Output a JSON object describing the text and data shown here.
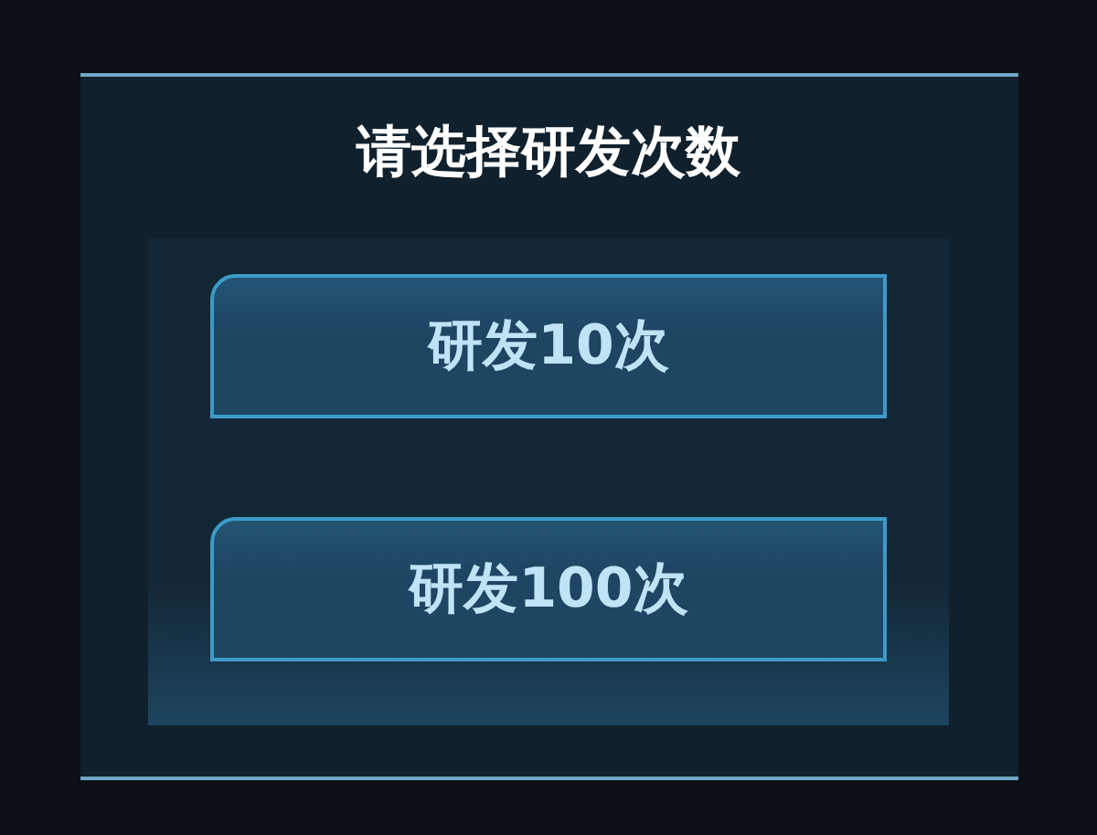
{
  "dialog": {
    "title": "请选择研发次数",
    "buttons": [
      {
        "label": "研发10次"
      },
      {
        "label": "研发100次"
      }
    ]
  }
}
